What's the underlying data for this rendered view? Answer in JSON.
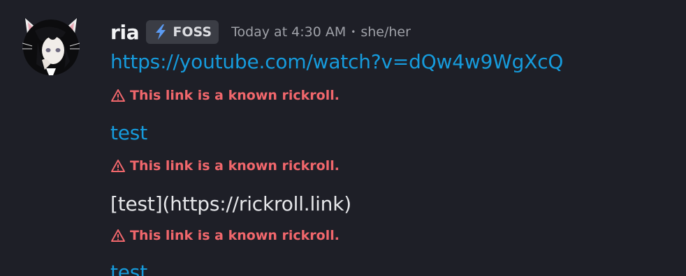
{
  "author": {
    "username": "ria",
    "tag": "FOSS",
    "tag_icon": "lightning-icon",
    "timestamp": "Today at 4:30 AM",
    "separator": "•",
    "pronouns": "she/her",
    "avatar": "anime-avatar-with-cat-ears"
  },
  "messages": [
    {
      "type": "link",
      "text": "https://youtube.com/watch?v=dQw4w9WgXcQ",
      "warning": "This link is a known rickroll."
    },
    {
      "type": "link",
      "text": "test",
      "warning": "This link is a known rickroll."
    },
    {
      "type": "text",
      "text": "[test](https://rickroll.link)",
      "warning": "This link is a known rickroll."
    },
    {
      "type": "link",
      "text": "test"
    }
  ],
  "colors": {
    "background": "#1e1f27",
    "link": "#169bdc",
    "warning": "#f1676c",
    "username": "#f2f3f5",
    "muted": "#9fa1a8"
  }
}
